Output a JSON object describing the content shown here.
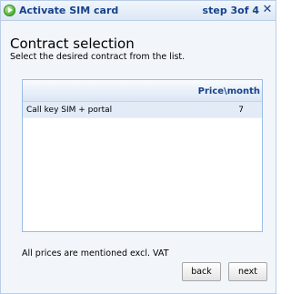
{
  "window": {
    "title": "Activate SIM card",
    "step": "step 3of 4",
    "close_glyph": "✕"
  },
  "page": {
    "heading": "Contract selection",
    "subheading": "Select the desired contract from the list."
  },
  "grid": {
    "columns": [
      "",
      "Price\\month"
    ],
    "rows": [
      {
        "name": "Call key SIM + portal",
        "price": "7"
      }
    ]
  },
  "footnote": "All prices are mentioned excl. VAT",
  "buttons": {
    "back": "back",
    "next": "next"
  },
  "colors": {
    "accent": "#15428b",
    "selected_row": "#e2ebf6",
    "border": "#99bbe8"
  },
  "icons": {
    "title": "green-arrow-circle-icon",
    "close": "close-icon"
  }
}
